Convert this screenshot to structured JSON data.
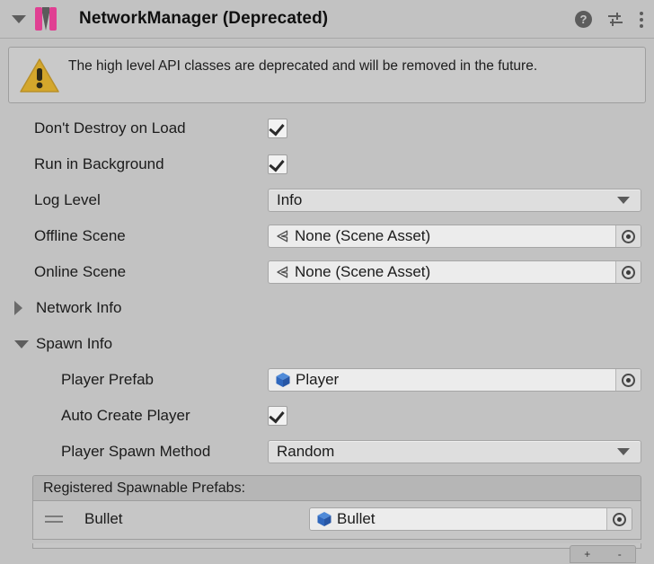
{
  "header": {
    "foldout_state": "expanded",
    "icon_name": "networkmanager-icon",
    "title": "NetworkManager (Deprecated)",
    "help_label": "?",
    "buttons": {
      "help": "help-icon",
      "settings": "preset-settings-icon",
      "menu": "kebab-menu-icon"
    }
  },
  "helpbox": {
    "type": "warning",
    "message": "The high level API classes are deprecated and will be removed in the future."
  },
  "properties": [
    {
      "label": "Don't Destroy on Load",
      "type": "toggle",
      "value": true
    },
    {
      "label": "Run in Background",
      "type": "toggle",
      "value": true
    },
    {
      "label": "Log Level",
      "type": "enum",
      "value": "Info"
    },
    {
      "label": "Offline Scene",
      "type": "object",
      "value": "None (Scene Asset)",
      "icon": "scene-asset-icon"
    },
    {
      "label": "Online Scene",
      "type": "object",
      "value": "None (Scene Asset)",
      "icon": "scene-asset-icon"
    }
  ],
  "foldouts": {
    "network_info": {
      "label": "Network Info",
      "expanded": false
    },
    "spawn_info": {
      "label": "Spawn Info",
      "expanded": true
    }
  },
  "spawn_properties": [
    {
      "label": "Player Prefab",
      "type": "object",
      "value": "Player",
      "icon": "prefab-icon"
    },
    {
      "label": "Auto Create Player",
      "type": "toggle",
      "value": true
    },
    {
      "label": "Player Spawn Method",
      "type": "enum",
      "value": "Random"
    }
  ],
  "spawnable_list": {
    "header": "Registered Spawnable Prefabs:",
    "rows": [
      {
        "label": "Bullet",
        "value": "Bullet",
        "icon": "prefab-icon"
      }
    ],
    "footer": {
      "add": "+",
      "remove": "-"
    }
  },
  "colors": {
    "background": "#c2c2c2",
    "field": "#ececec",
    "enum_field": "#dedede",
    "warning": "#d4a72c",
    "prefab_blue": "#2b6bc4",
    "icon_magenta": "#e03f92"
  }
}
